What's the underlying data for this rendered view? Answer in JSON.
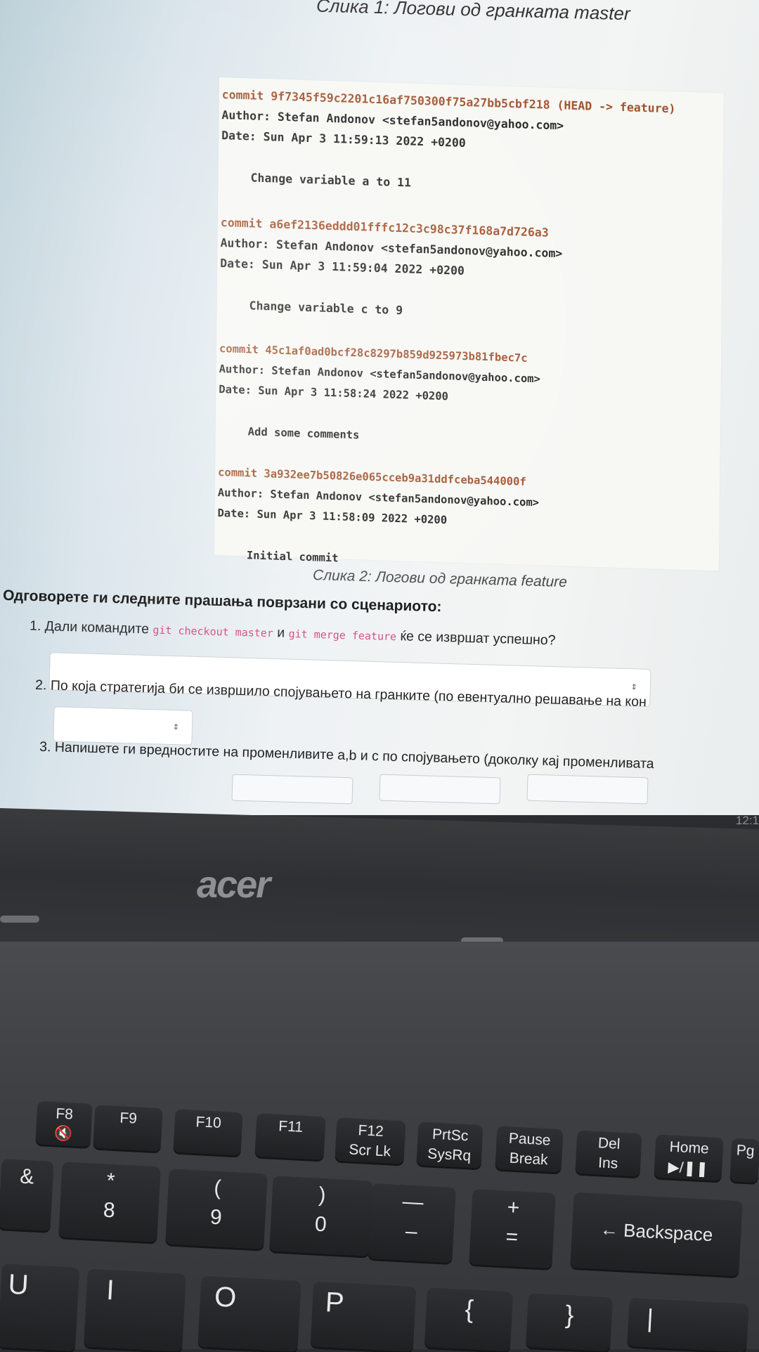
{
  "screen": {
    "caption1": "Слика 1: Логови од гранката master",
    "log": [
      {
        "commit_word": "commit",
        "hash": "9f7345f59c2201c16af750300f75a27bb5cbf218",
        "ref": " (HEAD -> feature)",
        "author": "Author: Stefan Andonov <stefan5andonov@yahoo.com>",
        "date": "Date:   Sun Apr 3 11:59:13 2022 +0200",
        "message": "Change variable a to 11"
      },
      {
        "commit_word": "commit",
        "hash": "a6ef2136eddd01fffc12c3c98c37f168a7d726a3",
        "ref": "",
        "author": "Author: Stefan Andonov <stefan5andonov@yahoo.com>",
        "date": "Date:   Sun Apr 3 11:59:04 2022 +0200",
        "message": "Change variable c to 9"
      },
      {
        "commit_word": "commit",
        "hash": "45c1af0ad0bcf28c8297b859d925973b81fbec7c",
        "ref": "",
        "author": "Author: Stefan Andonov <stefan5andonov@yahoo.com>",
        "date": "Date:   Sun Apr 3 11:58:24 2022 +0200",
        "message": "Add some comments"
      },
      {
        "commit_word": "commit",
        "hash": "3a932ee7b50826e065cceb9a31ddfceba544000f",
        "ref": "",
        "author": "Author: Stefan Andonov <stefan5andonov@yahoo.com>",
        "date": "Date:   Sun Apr 3 11:58:09 2022 +0200",
        "message": "Initial commit"
      }
    ],
    "caption2": "Слика 2: Логови од гранката feature",
    "section_title": "Одговорете ги следните прашања поврзани со сценариото:",
    "q1": {
      "prefix": "1. Дали командите ",
      "code1": "git checkout master",
      "mid": " и ",
      "code2": "git merge feature",
      "suffix": " ќе се извршат успешно?"
    },
    "q2": "2. По која стратегија би се извршило спојувањето на гранките (по евентуално решавање на кон",
    "q3": "3. Напишете ги вредностите на променливите a,b и c по спојувањето (доколку кај променливата",
    "clock": "12:1",
    "select_arrows": "⇕"
  },
  "laptop": {
    "brand": "acer",
    "keys": {
      "f8": {
        "top": "F8",
        "bot": "🔇"
      },
      "f9": {
        "top": "F9"
      },
      "f10": {
        "top": "F10"
      },
      "f11": {
        "top": "F11"
      },
      "f12": {
        "top": "F12",
        "bot": "Scr Lk"
      },
      "prtsc": {
        "top": "PrtSc",
        "bot": "SysRq"
      },
      "pause": {
        "top": "Pause",
        "bot": "Break"
      },
      "del": {
        "top": "Del",
        "bot": "Ins"
      },
      "home": {
        "top": "Home",
        "bot": "▶/❚❚"
      },
      "pg": {
        "top": "Pg"
      },
      "k7": {
        "top": "&"
      },
      "k8": {
        "top": "*",
        "bot": "8"
      },
      "k9": {
        "top": "(",
        "bot": "9"
      },
      "k0": {
        "top": ")",
        "bot": "0"
      },
      "minus": {
        "top": "—",
        "bot": "–"
      },
      "plus": {
        "top": "+",
        "bot": "="
      },
      "backspace": {
        "top": "← Backspace"
      },
      "u": {
        "top": "U"
      },
      "i": {
        "top": "I"
      },
      "o": {
        "top": "O"
      },
      "p": {
        "top": "P"
      },
      "lbrace": {
        "top": "{"
      },
      "rbrace": {
        "top": "}"
      },
      "pipe": {
        "top": "|"
      }
    }
  }
}
